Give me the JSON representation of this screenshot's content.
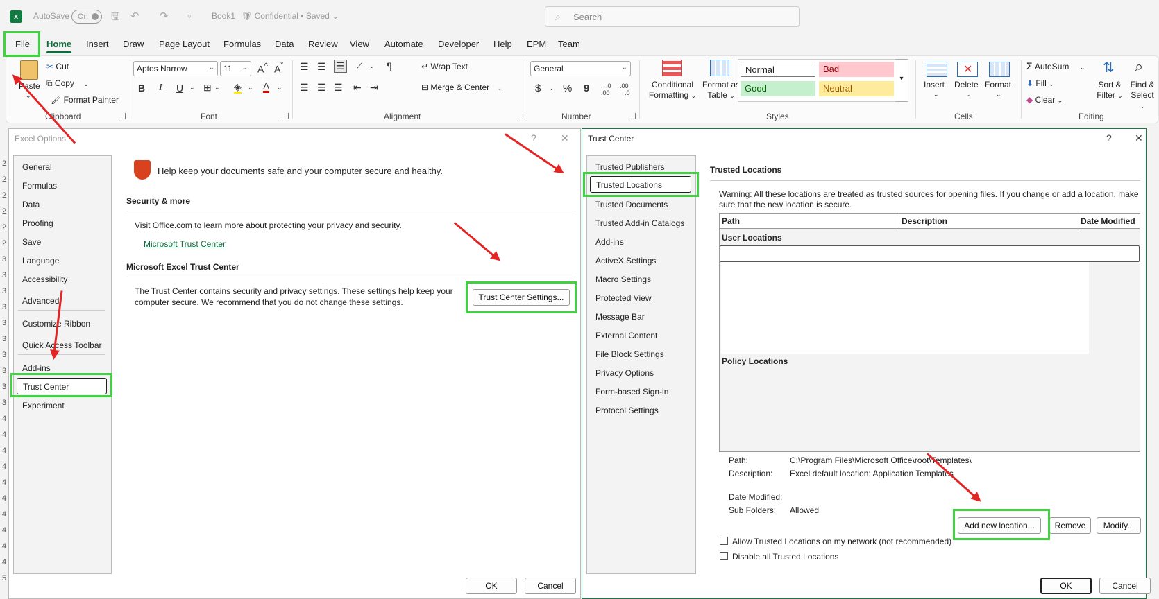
{
  "titlebar": {
    "autosave_label": "AutoSave",
    "autosave_state": "On",
    "doc_title": "Book1",
    "sensitivity": "Confidential • Saved",
    "search_placeholder": "Search"
  },
  "menu_tabs": [
    "File",
    "Home",
    "Insert",
    "Draw",
    "Page Layout",
    "Formulas",
    "Data",
    "Review",
    "View",
    "Automate",
    "Developer",
    "Help",
    "EPM",
    "Team"
  ],
  "active_tab": "Home",
  "ribbon": {
    "clipboard": {
      "paste": "Paste",
      "cut": "Cut",
      "copy": "Copy",
      "format_painter": "Format Painter",
      "group": "Clipboard"
    },
    "font": {
      "name": "Aptos Narrow",
      "size": "11",
      "group": "Font",
      "bold": "B",
      "italic": "I",
      "underline": "U"
    },
    "alignment": {
      "wrap_text": "Wrap Text",
      "merge_center": "Merge & Center",
      "group": "Alignment"
    },
    "number": {
      "format": "General",
      "currency": "$",
      "percent": "%",
      "comma": "9",
      "group": "Number"
    },
    "styles": {
      "conditional_formatting": "Conditional Formatting",
      "format_as_table": "Format as Table",
      "normal": "Normal",
      "bad": "Bad",
      "good": "Good",
      "neutral": "Neutral",
      "group": "Styles"
    },
    "cells": {
      "insert": "Insert",
      "delete": "Delete",
      "format": "Format",
      "group": "Cells"
    },
    "editing": {
      "autosum": "AutoSum",
      "fill": "Fill",
      "clear": "Clear",
      "sort_filter": "Sort & Filter",
      "find_select": "Find & Select",
      "group": "Editing"
    }
  },
  "excel_options": {
    "title": "Excel Options",
    "nav": [
      "General",
      "Formulas",
      "Data",
      "Proofing",
      "Save",
      "Language",
      "Accessibility",
      "Advanced",
      "Customize Ribbon",
      "Quick Access Toolbar",
      "Add-ins",
      "Trust Center",
      "Experiment"
    ],
    "selected": "Trust Center",
    "header": "Help keep your documents safe and your computer secure and healthy.",
    "security_heading": "Security & more",
    "security_text": "Visit Office.com to learn more about protecting your privacy and security.",
    "trust_link": "Microsoft Trust Center",
    "trust_center_heading": "Microsoft Excel Trust Center",
    "trust_center_text_1": "The Trust Center contains security and privacy settings. These settings help keep your",
    "trust_center_text_2": "computer secure. We recommend that you do not change these settings.",
    "trust_center_button": "Trust Center Settings...",
    "ok": "OK",
    "cancel": "Cancel",
    "help": "?",
    "close": "✕"
  },
  "trust_center": {
    "title": "Trust Center",
    "nav": [
      "Trusted Publishers",
      "Trusted Locations",
      "Trusted Documents",
      "Trusted Add-in Catalogs",
      "Add-ins",
      "ActiveX Settings",
      "Macro Settings",
      "Protected View",
      "Message Bar",
      "External Content",
      "File Block Settings",
      "Privacy Options",
      "Form-based Sign-in",
      "Protocol Settings"
    ],
    "selected": "Trusted Locations",
    "section_title": "Trusted Locations",
    "warning_1": "Warning: All these locations are treated as trusted sources for opening files.  If you change or add a location, make",
    "warning_2": "sure that the new location is secure.",
    "columns": [
      "Path",
      "Description",
      "Date Modified"
    ],
    "user_locations": "User Locations",
    "policy_locations": "Policy Locations",
    "details": {
      "path_label": "Path:",
      "path_value": "C:\\Program Files\\Microsoft Office\\root\\Templates\\",
      "desc_label": "Description:",
      "desc_value": "Excel default location: Application Templates",
      "date_label": "Date Modified:",
      "date_value": "",
      "sub_label": "Sub Folders:",
      "sub_value": "Allowed"
    },
    "add_button": "Add new location...",
    "remove_button": "Remove",
    "modify_button": "Modify...",
    "allow_network": "Allow Trusted Locations on my network (not recommended)",
    "disable_all": "Disable all Trusted Locations",
    "ok": "OK",
    "cancel": "Cancel",
    "help": "?",
    "close": "✕"
  },
  "colors": {
    "excel_green": "#107c41",
    "highlight_green": "#3fd33f",
    "arrow_red": "#e32525",
    "bad_fill": "#ffc7ce",
    "good_fill": "#c6efce",
    "neutral_fill": "#ffeb9c"
  }
}
